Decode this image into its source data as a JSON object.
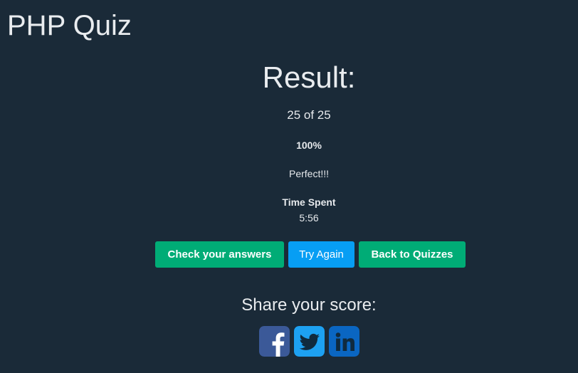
{
  "page": {
    "title": "PHP Quiz"
  },
  "result": {
    "heading": "Result:",
    "score": "25 of 25",
    "percent": "100%",
    "verdict": "Perfect!!!",
    "time_label": "Time Spent",
    "time_value": "5:56"
  },
  "actions": {
    "check_label": "Check your answers",
    "retry_label": "Try Again",
    "back_label": "Back to Quizzes"
  },
  "share": {
    "heading": "Share your score:",
    "networks": [
      {
        "name": "facebook",
        "icon": "facebook-icon",
        "color": "#3b5998"
      },
      {
        "name": "twitter",
        "icon": "twitter-icon",
        "color": "#1da1f2"
      },
      {
        "name": "linkedin",
        "icon": "linkedin-icon",
        "color": "#0a66c2"
      }
    ]
  },
  "colors": {
    "background": "#1a2a38",
    "text": "#e6e9ec",
    "success": "#00ac76",
    "primary": "#079ef4"
  }
}
